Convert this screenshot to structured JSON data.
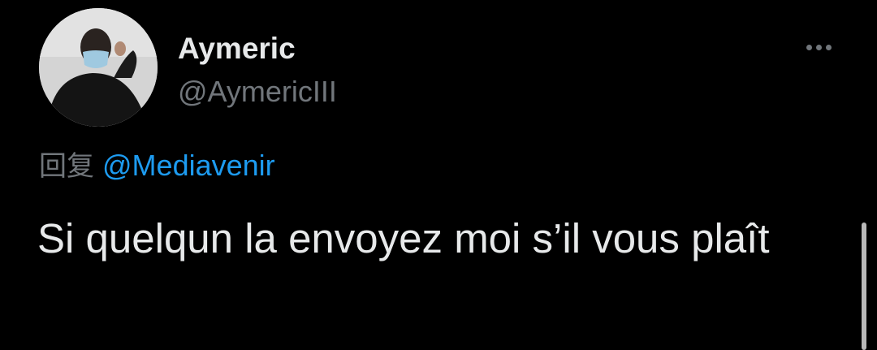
{
  "author": {
    "display_name": "Aymeric",
    "handle": "@AymericIII",
    "avatar": "profile-photo"
  },
  "reply": {
    "prefix": "回复",
    "mention": "@Mediavenir"
  },
  "tweet": {
    "text": "Si quelqun la envoyez moi s’il vous plaît"
  },
  "icons": {
    "more": "more-horizontal-icon"
  },
  "colors": {
    "background": "#000000",
    "primary_text": "#e7e9ea",
    "secondary_text": "#71767b",
    "link": "#1d9bf0"
  }
}
